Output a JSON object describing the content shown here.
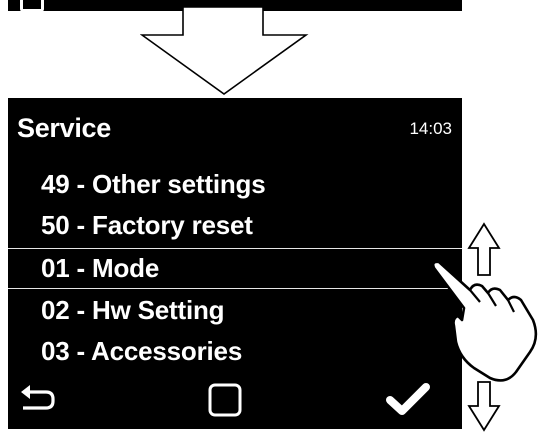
{
  "screen": {
    "title": "Service",
    "time": "14:03",
    "menu": [
      {
        "label": "49 - Other settings"
      },
      {
        "label": "50 - Factory reset"
      },
      {
        "label": "01 - Mode"
      },
      {
        "label": "02 - Hw Setting"
      },
      {
        "label": "03 - Accessories"
      }
    ],
    "selected_index": 2
  },
  "icons": {
    "back": "back-arrow-icon",
    "home": "square-icon",
    "confirm": "checkmark-icon",
    "scroll_up": "up-arrow-icon",
    "scroll_down": "down-arrow-icon",
    "gesture": "swipe-hand-icon",
    "transition": "down-arrow-icon"
  },
  "colors": {
    "screen_bg": "#000000",
    "text": "#ffffff",
    "page_bg": "#ffffff"
  }
}
